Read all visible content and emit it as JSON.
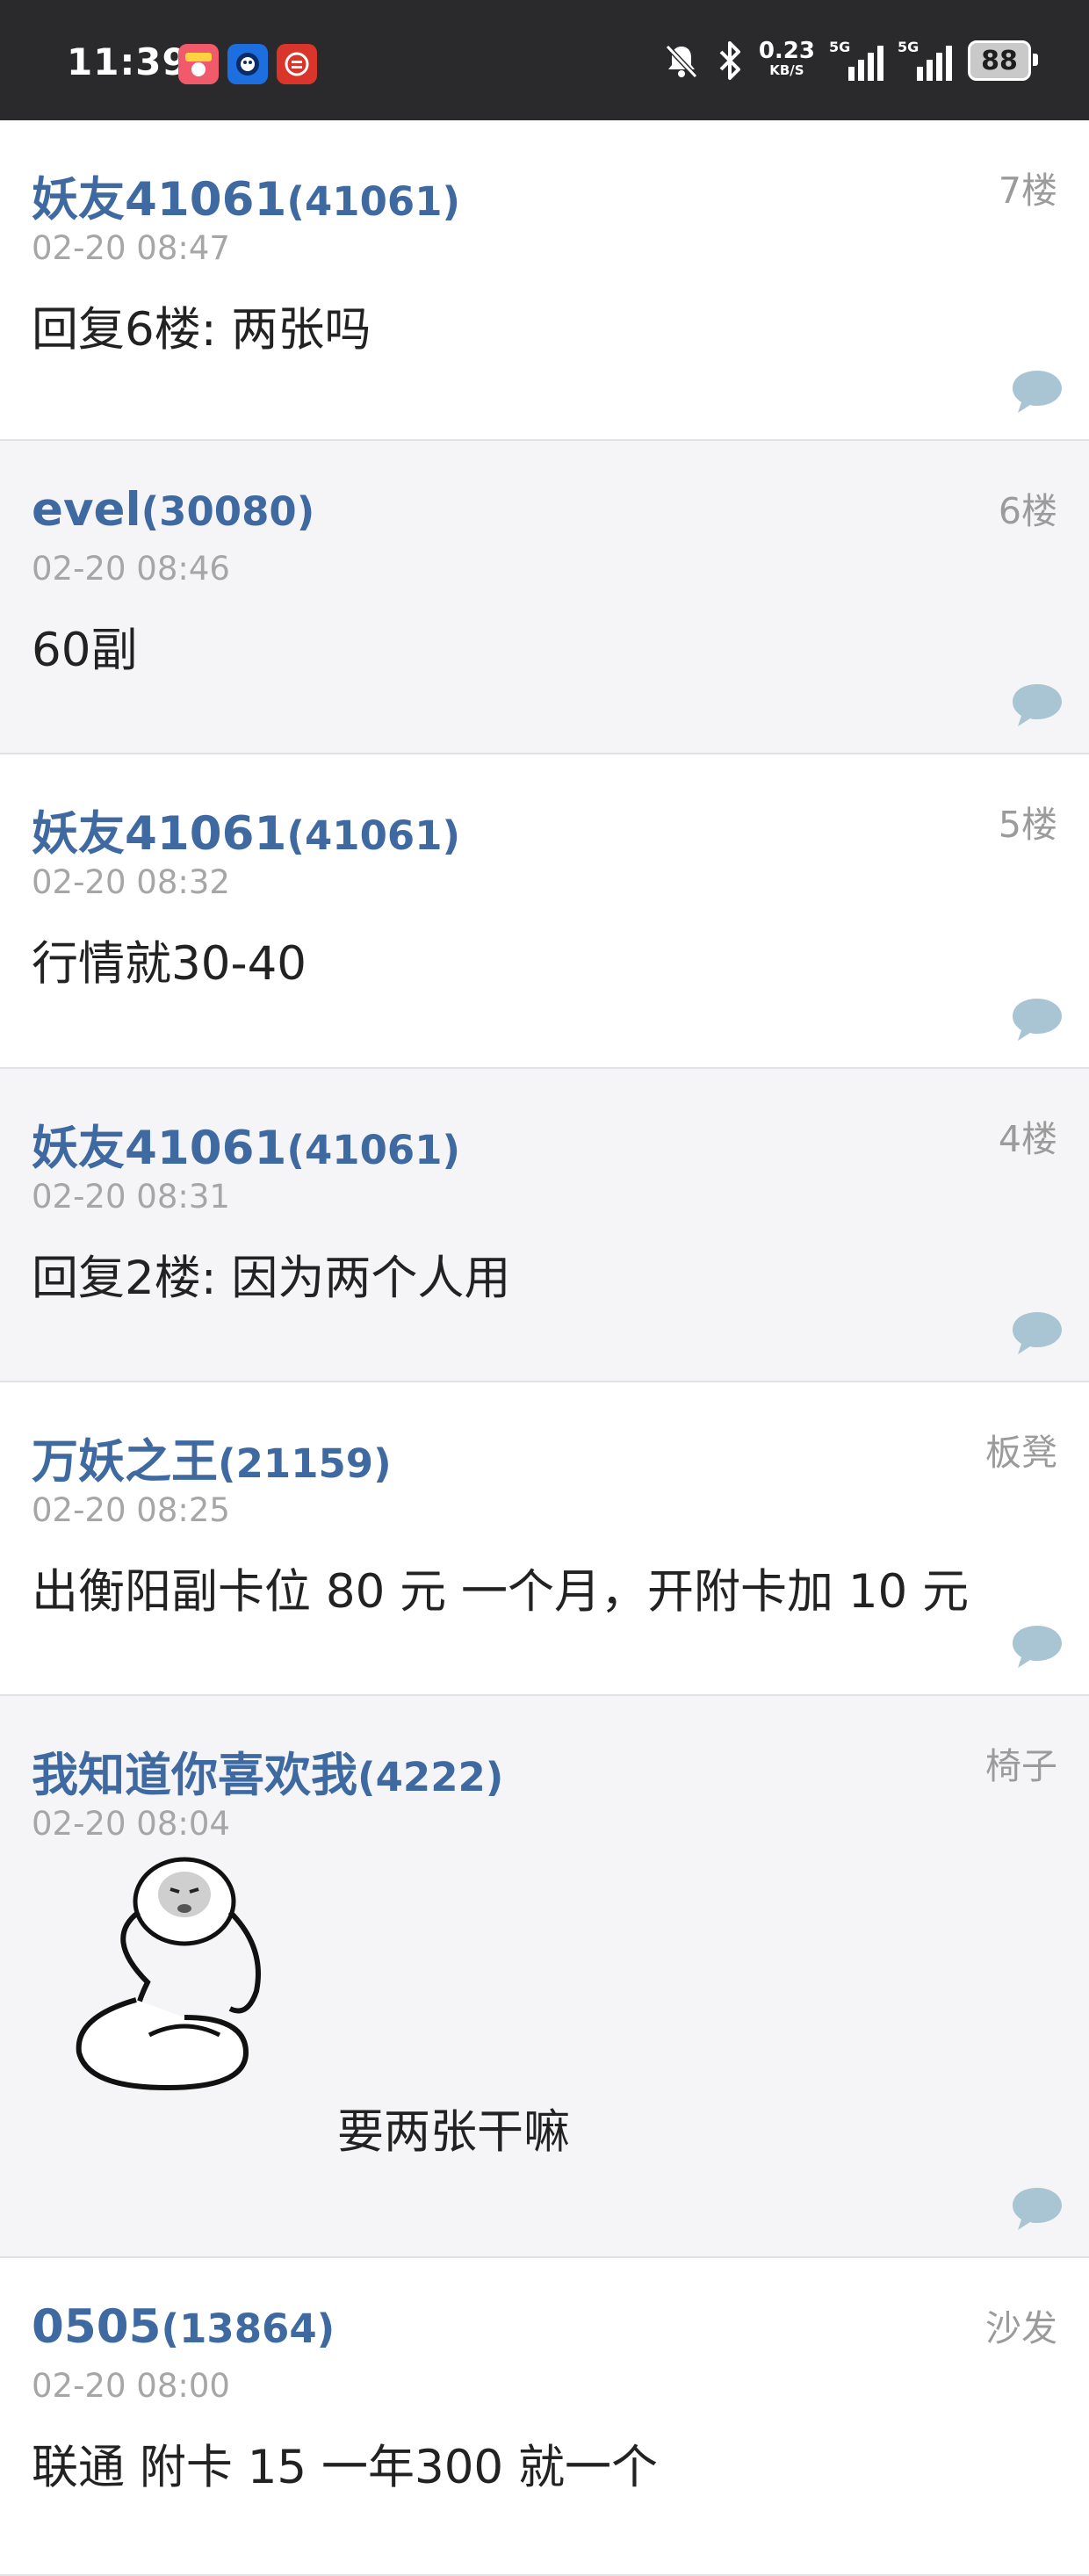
{
  "status_bar": {
    "time": "11:39",
    "net_speed": "0.23",
    "net_unit": "KB/S",
    "sim1": "5G",
    "sim2": "5G",
    "battery": "88"
  },
  "posts": [
    {
      "user": "妖友41061",
      "uid": "(41061)",
      "floor": "7楼",
      "time": "02-20 08:47",
      "content": "回复6楼: 两张吗"
    },
    {
      "user": "evel",
      "uid": "(30080)",
      "floor": "6楼",
      "time": "02-20 08:46",
      "content": "60副"
    },
    {
      "user": "妖友41061",
      "uid": "(41061)",
      "floor": "5楼",
      "time": "02-20 08:32",
      "content": "行情就30-40"
    },
    {
      "user": "妖友41061",
      "uid": "(41061)",
      "floor": "4楼",
      "time": "02-20 08:31",
      "content": "回复2楼: 因为两个人用"
    },
    {
      "user": "万妖之王",
      "uid": "(21159)",
      "floor": "板凳",
      "time": "02-20 08:25",
      "content": "出衡阳副卡位 80 元 一个月，开附卡加 10 元"
    },
    {
      "user": "我知道你喜欢我",
      "uid": "(4222)",
      "floor": "椅子",
      "time": "02-20 08:04",
      "content": "要两张干嘛"
    },
    {
      "user": "0505",
      "uid": "(13864)",
      "floor": "沙发",
      "time": "02-20 08:00",
      "content": "联通 附卡 15 一年300 就一个"
    }
  ],
  "colors": {
    "username": "#3f6aa1",
    "reply_icon": "#a9c5d3"
  }
}
